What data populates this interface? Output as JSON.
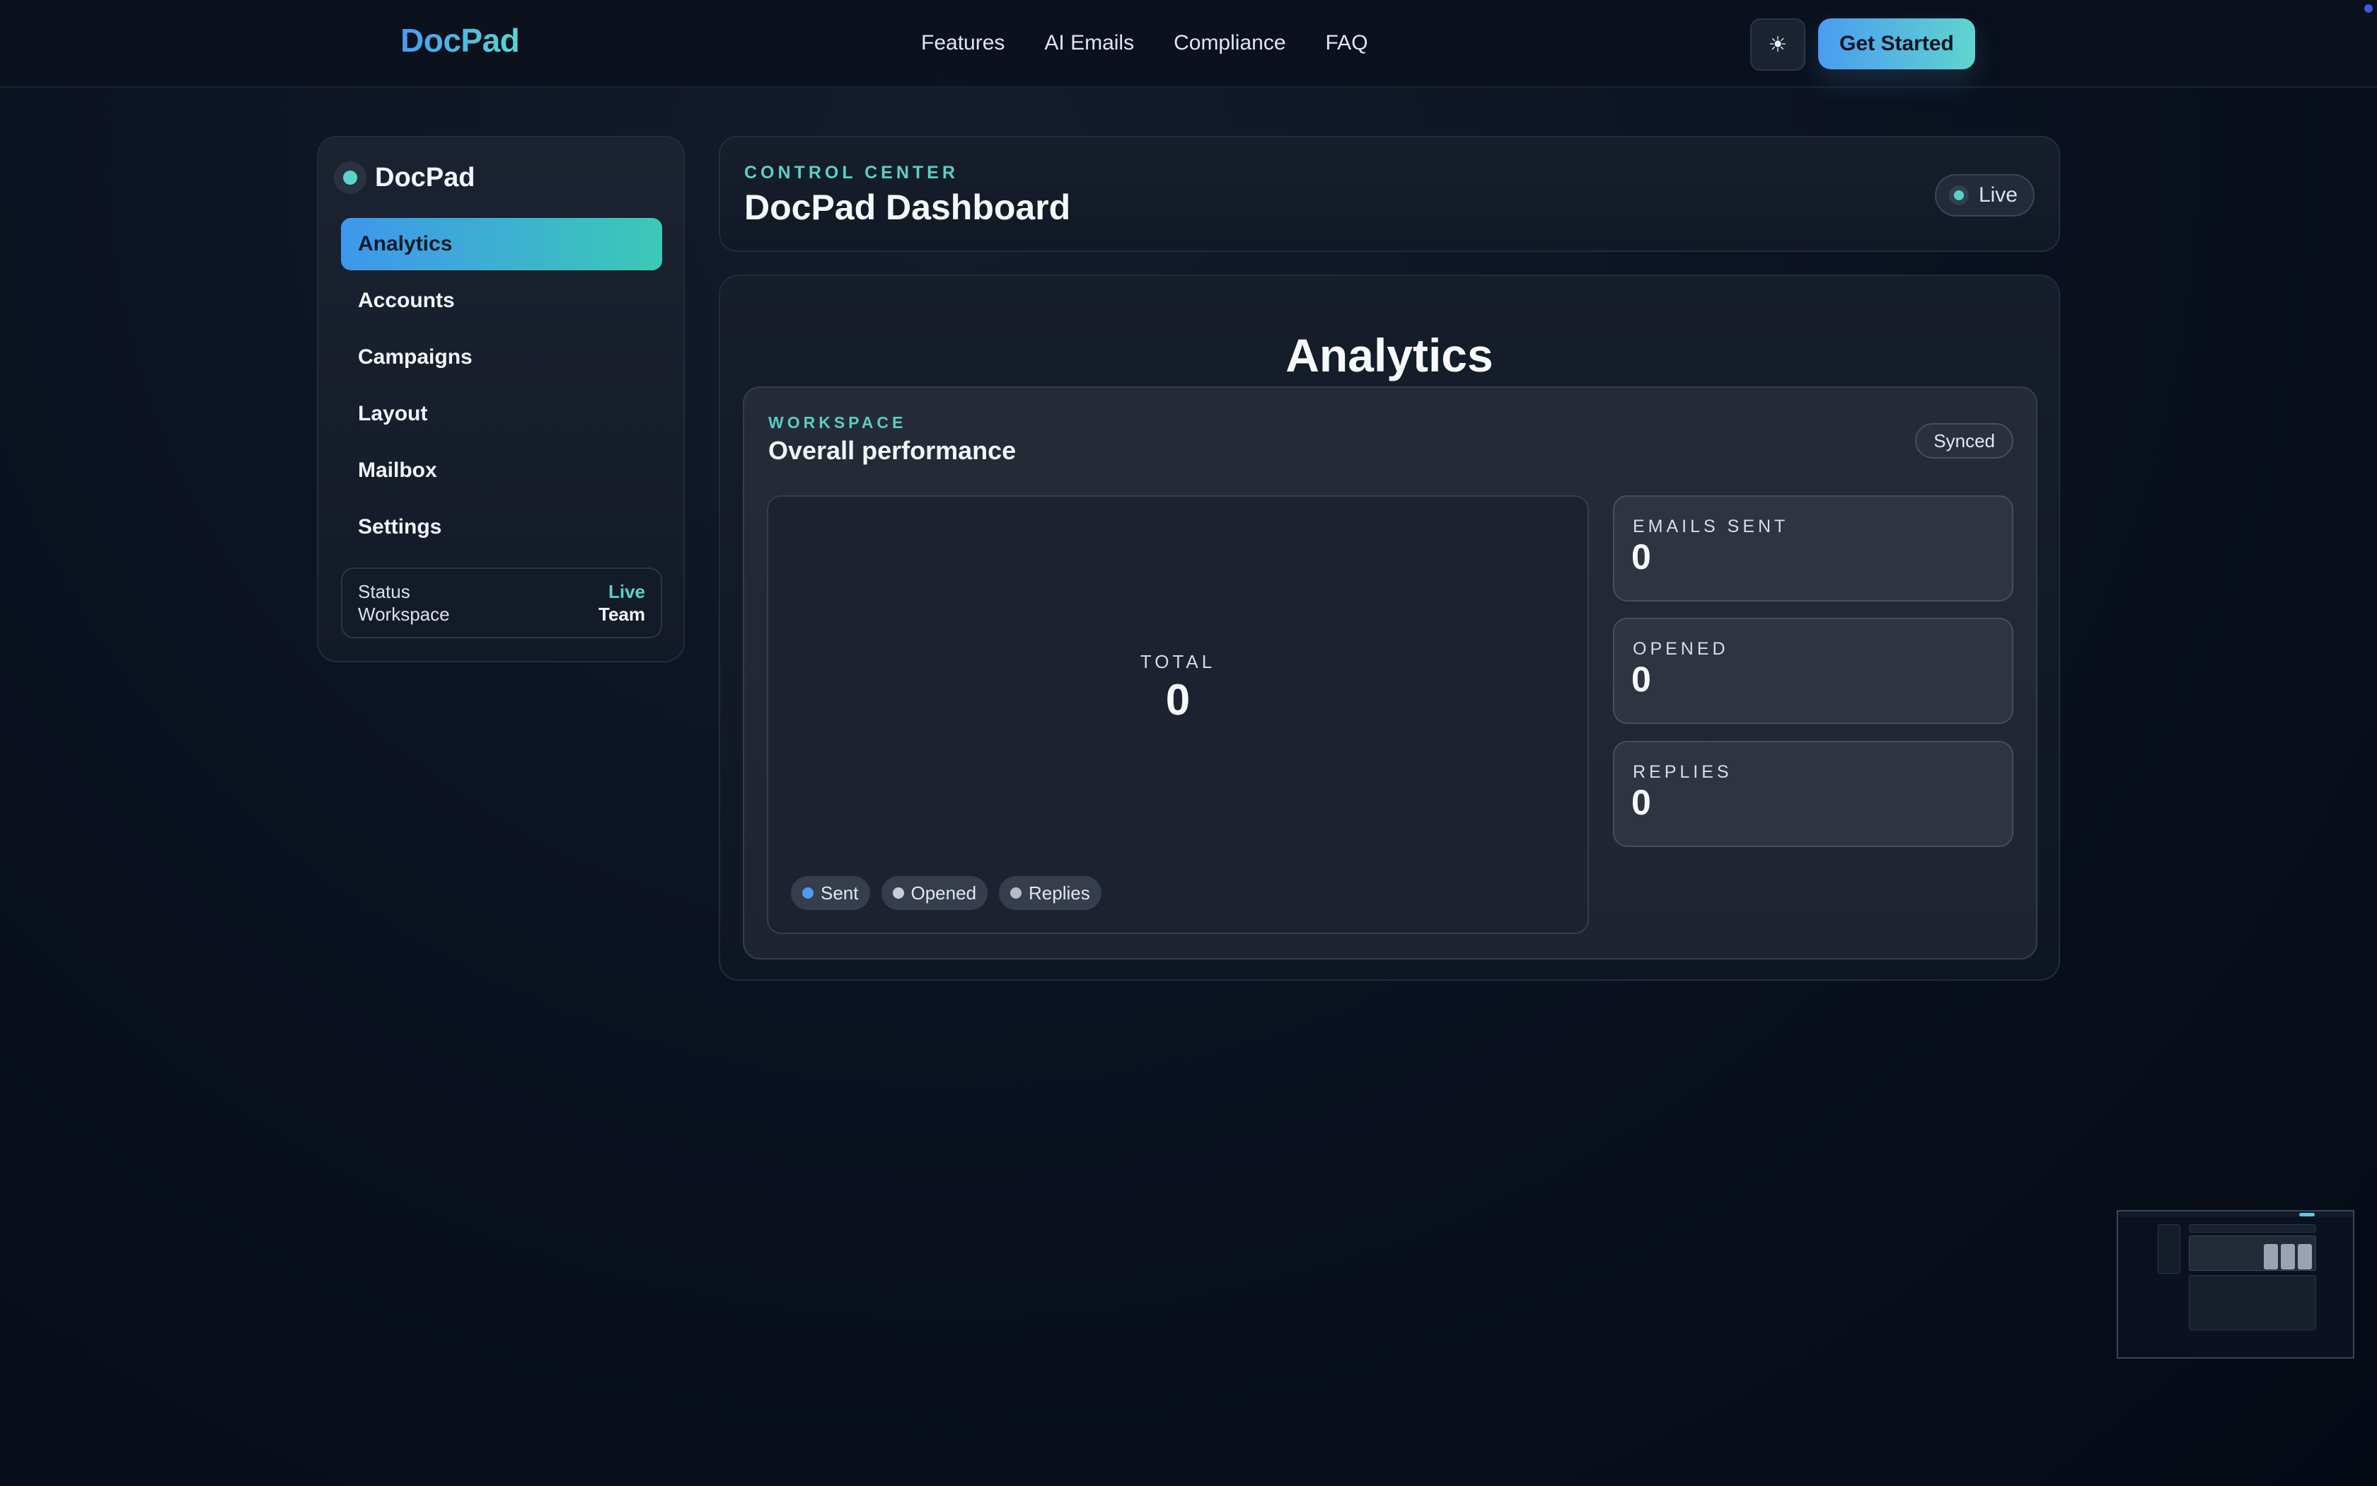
{
  "nav": {
    "brand": "DocPad",
    "links": [
      "Features",
      "AI Emails",
      "Compliance",
      "FAQ"
    ],
    "theme_icon": "sun-icon",
    "theme_glyph": "☀",
    "cta_label": "Get Started"
  },
  "sidebar": {
    "brand": "DocPad",
    "items": [
      {
        "label": "Analytics",
        "active": true
      },
      {
        "label": "Accounts",
        "active": false
      },
      {
        "label": "Campaigns",
        "active": false
      },
      {
        "label": "Layout",
        "active": false
      },
      {
        "label": "Mailbox",
        "active": false
      },
      {
        "label": "Settings",
        "active": false
      }
    ],
    "status": {
      "status_label": "Status",
      "status_value": "Live",
      "workspace_label": "Workspace",
      "workspace_value": "Team"
    }
  },
  "header": {
    "eyebrow": "CONTROL CENTER",
    "title": "DocPad Dashboard",
    "badge": "Live"
  },
  "analytics": {
    "title": "Analytics",
    "workspace": {
      "eyebrow": "WORKSPACE",
      "title": "Overall performance",
      "badge": "Synced"
    },
    "total": {
      "label": "TOTAL",
      "value": "0"
    },
    "legend": [
      {
        "label": "Sent",
        "color": "#4a9cf1"
      },
      {
        "label": "Opened",
        "color": "#c9ced6"
      },
      {
        "label": "Replies",
        "color": "#b6bcc6"
      }
    ],
    "stats": [
      {
        "label": "EMAILS SENT",
        "value": "0"
      },
      {
        "label": "OPENED",
        "value": "0"
      },
      {
        "label": "REPLIES",
        "value": "0"
      }
    ]
  },
  "colors": {
    "accent_blue": "#4a9cf1",
    "accent_teal": "#5ad0c8",
    "background": "#0b1221"
  }
}
